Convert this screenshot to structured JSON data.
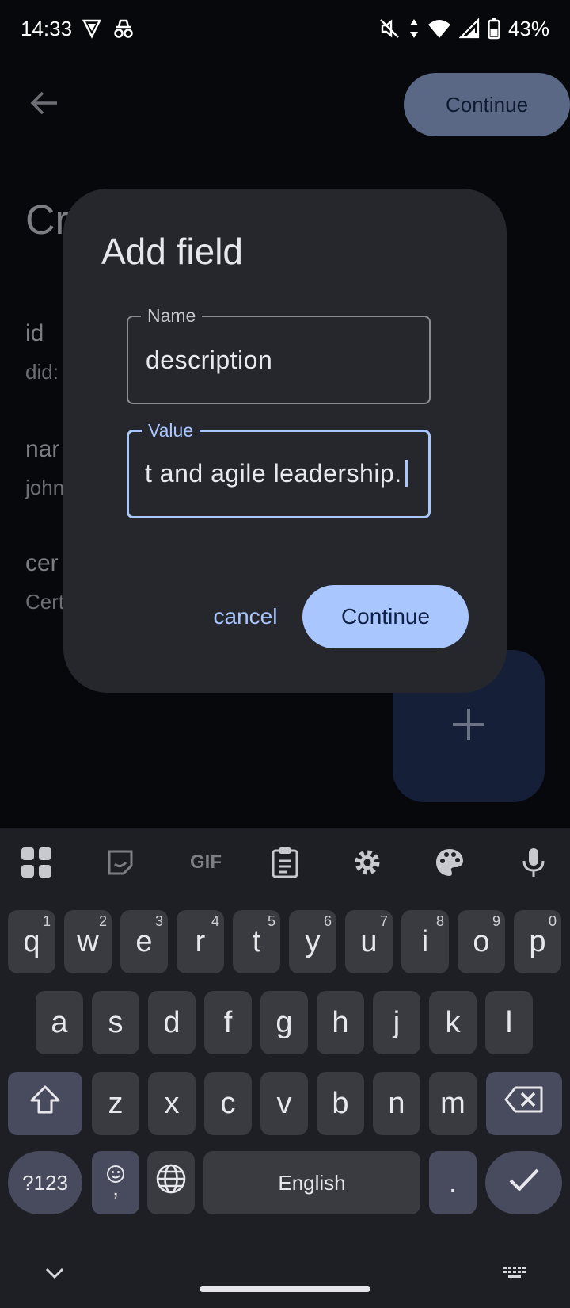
{
  "status_bar": {
    "time": "14:33",
    "battery": "43%"
  },
  "page": {
    "title": "Cr",
    "continue_label": "Continue",
    "fields": [
      {
        "key": "id",
        "value": "did:"
      },
      {
        "key": "nar",
        "value": "john"
      },
      {
        "key": "cer",
        "value": "Cert"
      }
    ],
    "fab_icon": "plus-icon"
  },
  "dialog": {
    "title": "Add field",
    "name_label": "Name",
    "name_value": "description",
    "value_label": "Value",
    "value_text": "t and agile leadership.",
    "cancel_label": "cancel",
    "continue_label": "Continue"
  },
  "keyboard": {
    "toolbar": [
      "apps-icon",
      "sticker-icon",
      "gif-icon",
      "clipboard-icon",
      "settings-icon",
      "palette-icon",
      "mic-icon"
    ],
    "gif_label": "GIF",
    "row1": [
      {
        "k": "q",
        "h": "1"
      },
      {
        "k": "w",
        "h": "2"
      },
      {
        "k": "e",
        "h": "3"
      },
      {
        "k": "r",
        "h": "4"
      },
      {
        "k": "t",
        "h": "5"
      },
      {
        "k": "y",
        "h": "6"
      },
      {
        "k": "u",
        "h": "7"
      },
      {
        "k": "i",
        "h": "8"
      },
      {
        "k": "o",
        "h": "9"
      },
      {
        "k": "p",
        "h": "0"
      }
    ],
    "row2": [
      "a",
      "s",
      "d",
      "f",
      "g",
      "h",
      "j",
      "k",
      "l"
    ],
    "row3": [
      "z",
      "x",
      "c",
      "v",
      "b",
      "n",
      "m"
    ],
    "symbols_label": "?123",
    "emoji_comma": ",",
    "space_label": "English",
    "period_label": "."
  },
  "colors": {
    "accent": "#a9c6ff",
    "dialog": "#25272d",
    "background": "#07080b",
    "keyboard": "#1e1f24"
  }
}
